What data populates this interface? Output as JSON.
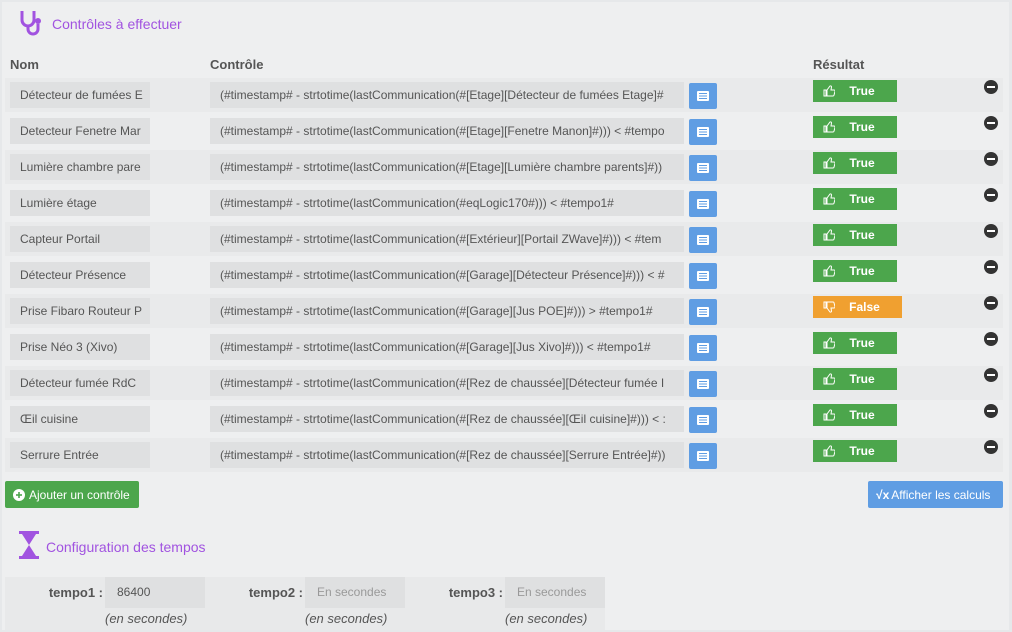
{
  "header": {
    "title": "Contrôles à effectuer"
  },
  "columns": {
    "name": "Nom",
    "control": "Contrôle",
    "result": "Résultat"
  },
  "rows": [
    {
      "name": "Détecteur de fumées E",
      "control": "(#timestamp# - strtotime(lastCommunication(#[Etage][Détecteur de fumées Etage]#",
      "result": "True",
      "ok": true
    },
    {
      "name": "Detecteur Fenetre Mar",
      "control": "(#timestamp# - strtotime(lastCommunication(#[Etage][Fenetre Manon]#))) < #tempo",
      "result": "True",
      "ok": true
    },
    {
      "name": "Lumière chambre pare",
      "control": "(#timestamp# - strtotime(lastCommunication(#[Etage][Lumière chambre parents]#))",
      "result": "True",
      "ok": true
    },
    {
      "name": "Lumière étage",
      "control": "(#timestamp# - strtotime(lastCommunication(#eqLogic170#))) < #tempo1#",
      "result": "True",
      "ok": true
    },
    {
      "name": "Capteur Portail",
      "control": "(#timestamp# - strtotime(lastCommunication(#[Extérieur][Portail ZWave]#))) < #tem",
      "result": "True",
      "ok": true
    },
    {
      "name": "Détecteur Présence",
      "control": "(#timestamp# - strtotime(lastCommunication(#[Garage][Détecteur Présence]#))) < #",
      "result": "True",
      "ok": true
    },
    {
      "name": "Prise Fibaro Routeur P",
      "control": "(#timestamp# - strtotime(lastCommunication(#[Garage][Jus POE]#))) > #tempo1#",
      "result": "False",
      "ok": false
    },
    {
      "name": "Prise Néo 3 (Xivo)",
      "control": "(#timestamp# - strtotime(lastCommunication(#[Garage][Jus Xivo]#))) < #tempo1#",
      "result": "True",
      "ok": true
    },
    {
      "name": "Détecteur fumée RdC",
      "control": "(#timestamp# - strtotime(lastCommunication(#[Rez de chaussée][Détecteur fumée I",
      "result": "True",
      "ok": true
    },
    {
      "name": "Œil cuisine",
      "control": "(#timestamp# - strtotime(lastCommunication(#[Rez de chaussée][Œil cuisine]#))) < :",
      "result": "True",
      "ok": true
    },
    {
      "name": "Serrure Entrée",
      "control": "(#timestamp# - strtotime(lastCommunication(#[Rez de chaussée][Serrure Entrée]#))",
      "result": "True",
      "ok": true
    }
  ],
  "actions": {
    "add_label": "Ajouter un contrôle",
    "show_calc_label": "Afficher les calculs"
  },
  "tempos": {
    "title": "Configuration des tempos",
    "items": [
      {
        "label": "tempo1 :",
        "value": "86400",
        "placeholder": "En secondes",
        "help": "(en secondes)"
      },
      {
        "label": "tempo2 :",
        "value": "",
        "placeholder": "En secondes",
        "help": "(en secondes)"
      },
      {
        "label": "tempo3 :",
        "value": "",
        "placeholder": "En secondes",
        "help": "(en secondes)"
      }
    ]
  },
  "colors": {
    "accent": "#a153e0",
    "success": "#4ca64c",
    "warning": "#f0a030",
    "info": "#5f9de3"
  }
}
